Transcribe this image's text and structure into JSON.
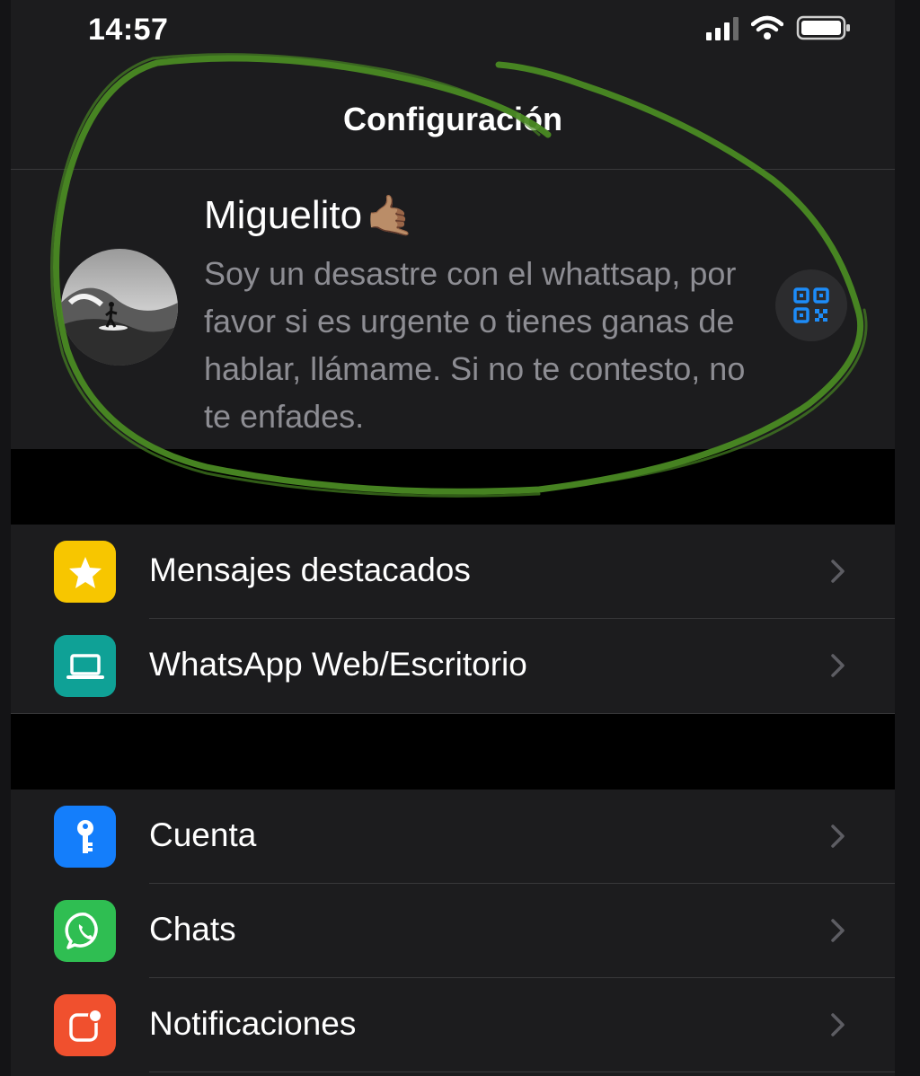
{
  "status_bar": {
    "time": "14:57"
  },
  "header": {
    "title": "Configuración"
  },
  "profile": {
    "name": "Miguelito",
    "name_emoji": "🤙🏽",
    "status": "Soy un desastre con el whattsap, por favor si es urgente o tienes ganas de hablar, llámame. Si no te contesto, no te enfades."
  },
  "section1": {
    "items": [
      {
        "label": "Mensajes destacados",
        "icon": "star-icon",
        "color": "#f7c600"
      },
      {
        "label": "WhatsApp Web/Escritorio",
        "icon": "laptop-icon",
        "color": "#0fa196"
      }
    ]
  },
  "section2": {
    "items": [
      {
        "label": "Cuenta",
        "icon": "key-icon",
        "color": "#147efb"
      },
      {
        "label": "Chats",
        "icon": "whatsapp-icon",
        "color": "#2fbe52"
      },
      {
        "label": "Notificaciones",
        "icon": "notification-icon",
        "color": "#f0502e"
      }
    ]
  },
  "colors": {
    "background": "#1c1c1e",
    "secondary_text": "#8d8d93",
    "qr_accent": "#1d8cf8",
    "annotation": "#4a8a23"
  }
}
